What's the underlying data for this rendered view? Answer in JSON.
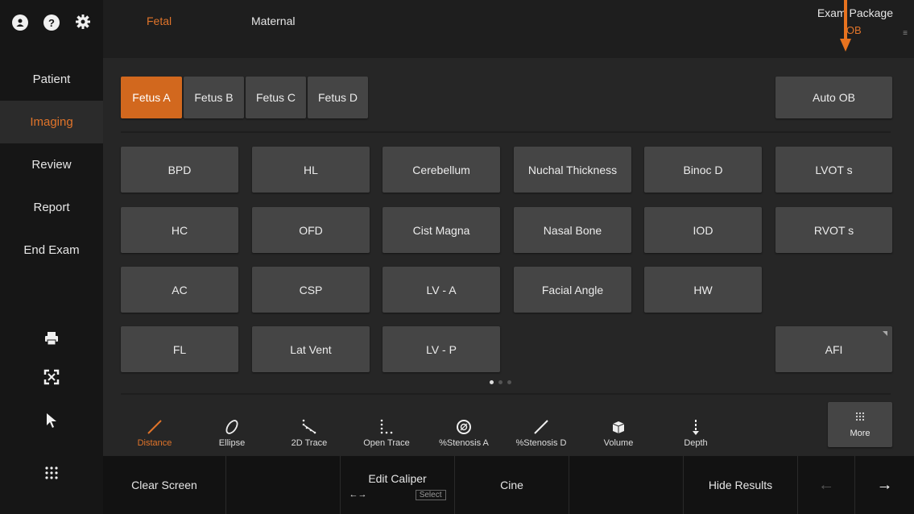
{
  "sidebar": {
    "top_icons": [
      "user-icon",
      "help-icon",
      "settings-icon"
    ],
    "help_glyph": "?",
    "items": [
      {
        "label": "Patient",
        "active": false
      },
      {
        "label": "Imaging",
        "active": true
      },
      {
        "label": "Review",
        "active": false
      },
      {
        "label": "Report",
        "active": false
      },
      {
        "label": "End Exam",
        "active": false
      }
    ],
    "tools": [
      "printer-icon",
      "fullscreen-icon",
      "pointer-icon",
      "apps-grid-icon"
    ]
  },
  "topbar": {
    "tabs": [
      {
        "label": "Fetal",
        "active": true
      },
      {
        "label": "Maternal",
        "active": false
      }
    ],
    "exam_package_label": "Exam Package",
    "exam_package_value": "OB"
  },
  "fetus_tabs": [
    {
      "label": "Fetus A",
      "active": true
    },
    {
      "label": "Fetus B",
      "active": false
    },
    {
      "label": "Fetus C",
      "active": false
    },
    {
      "label": "Fetus D",
      "active": false
    }
  ],
  "auto_ob_label": "Auto OB",
  "measurements": {
    "row1": [
      "BPD",
      "HL",
      "Cerebellum",
      "Nuchal Thickness",
      "Binoc D",
      "LVOT s"
    ],
    "row2": [
      "HC",
      "OFD",
      "Cist Magna",
      "Nasal Bone",
      "IOD",
      "RVOT s"
    ],
    "row3": [
      "AC",
      "CSP",
      "LV - A",
      "Facial Angle",
      "HW"
    ],
    "row4": [
      "FL",
      "Lat Vent",
      "LV - P",
      "AFI"
    ]
  },
  "pagination": {
    "pages": 3,
    "current": 1
  },
  "tools": [
    {
      "label": "Distance",
      "icon": "distance-icon",
      "active": true
    },
    {
      "label": "Ellipse",
      "icon": "ellipse-icon",
      "active": false
    },
    {
      "label": "2D Trace",
      "icon": "trace-2d-icon",
      "active": false
    },
    {
      "label": "Open Trace",
      "icon": "open-trace-icon",
      "active": false
    },
    {
      "label": "%Stenosis A",
      "icon": "stenosis-area-icon",
      "active": false
    },
    {
      "label": "%Stenosis D",
      "icon": "stenosis-diameter-icon",
      "active": false
    },
    {
      "label": "Volume",
      "icon": "volume-icon",
      "active": false
    },
    {
      "label": "Depth",
      "icon": "depth-icon",
      "active": false
    }
  ],
  "more_label": "More",
  "bottombar": {
    "clear_screen": "Clear Screen",
    "edit_caliper": "Edit Caliper",
    "edit_caliper_sub": "←→",
    "select": "Select",
    "cine": "Cine",
    "hide_results": "Hide Results",
    "back_arrow": "←",
    "forward_arrow": "→"
  },
  "colors": {
    "accent": "#d2681e",
    "annotation_arrow": "#e8731f"
  }
}
